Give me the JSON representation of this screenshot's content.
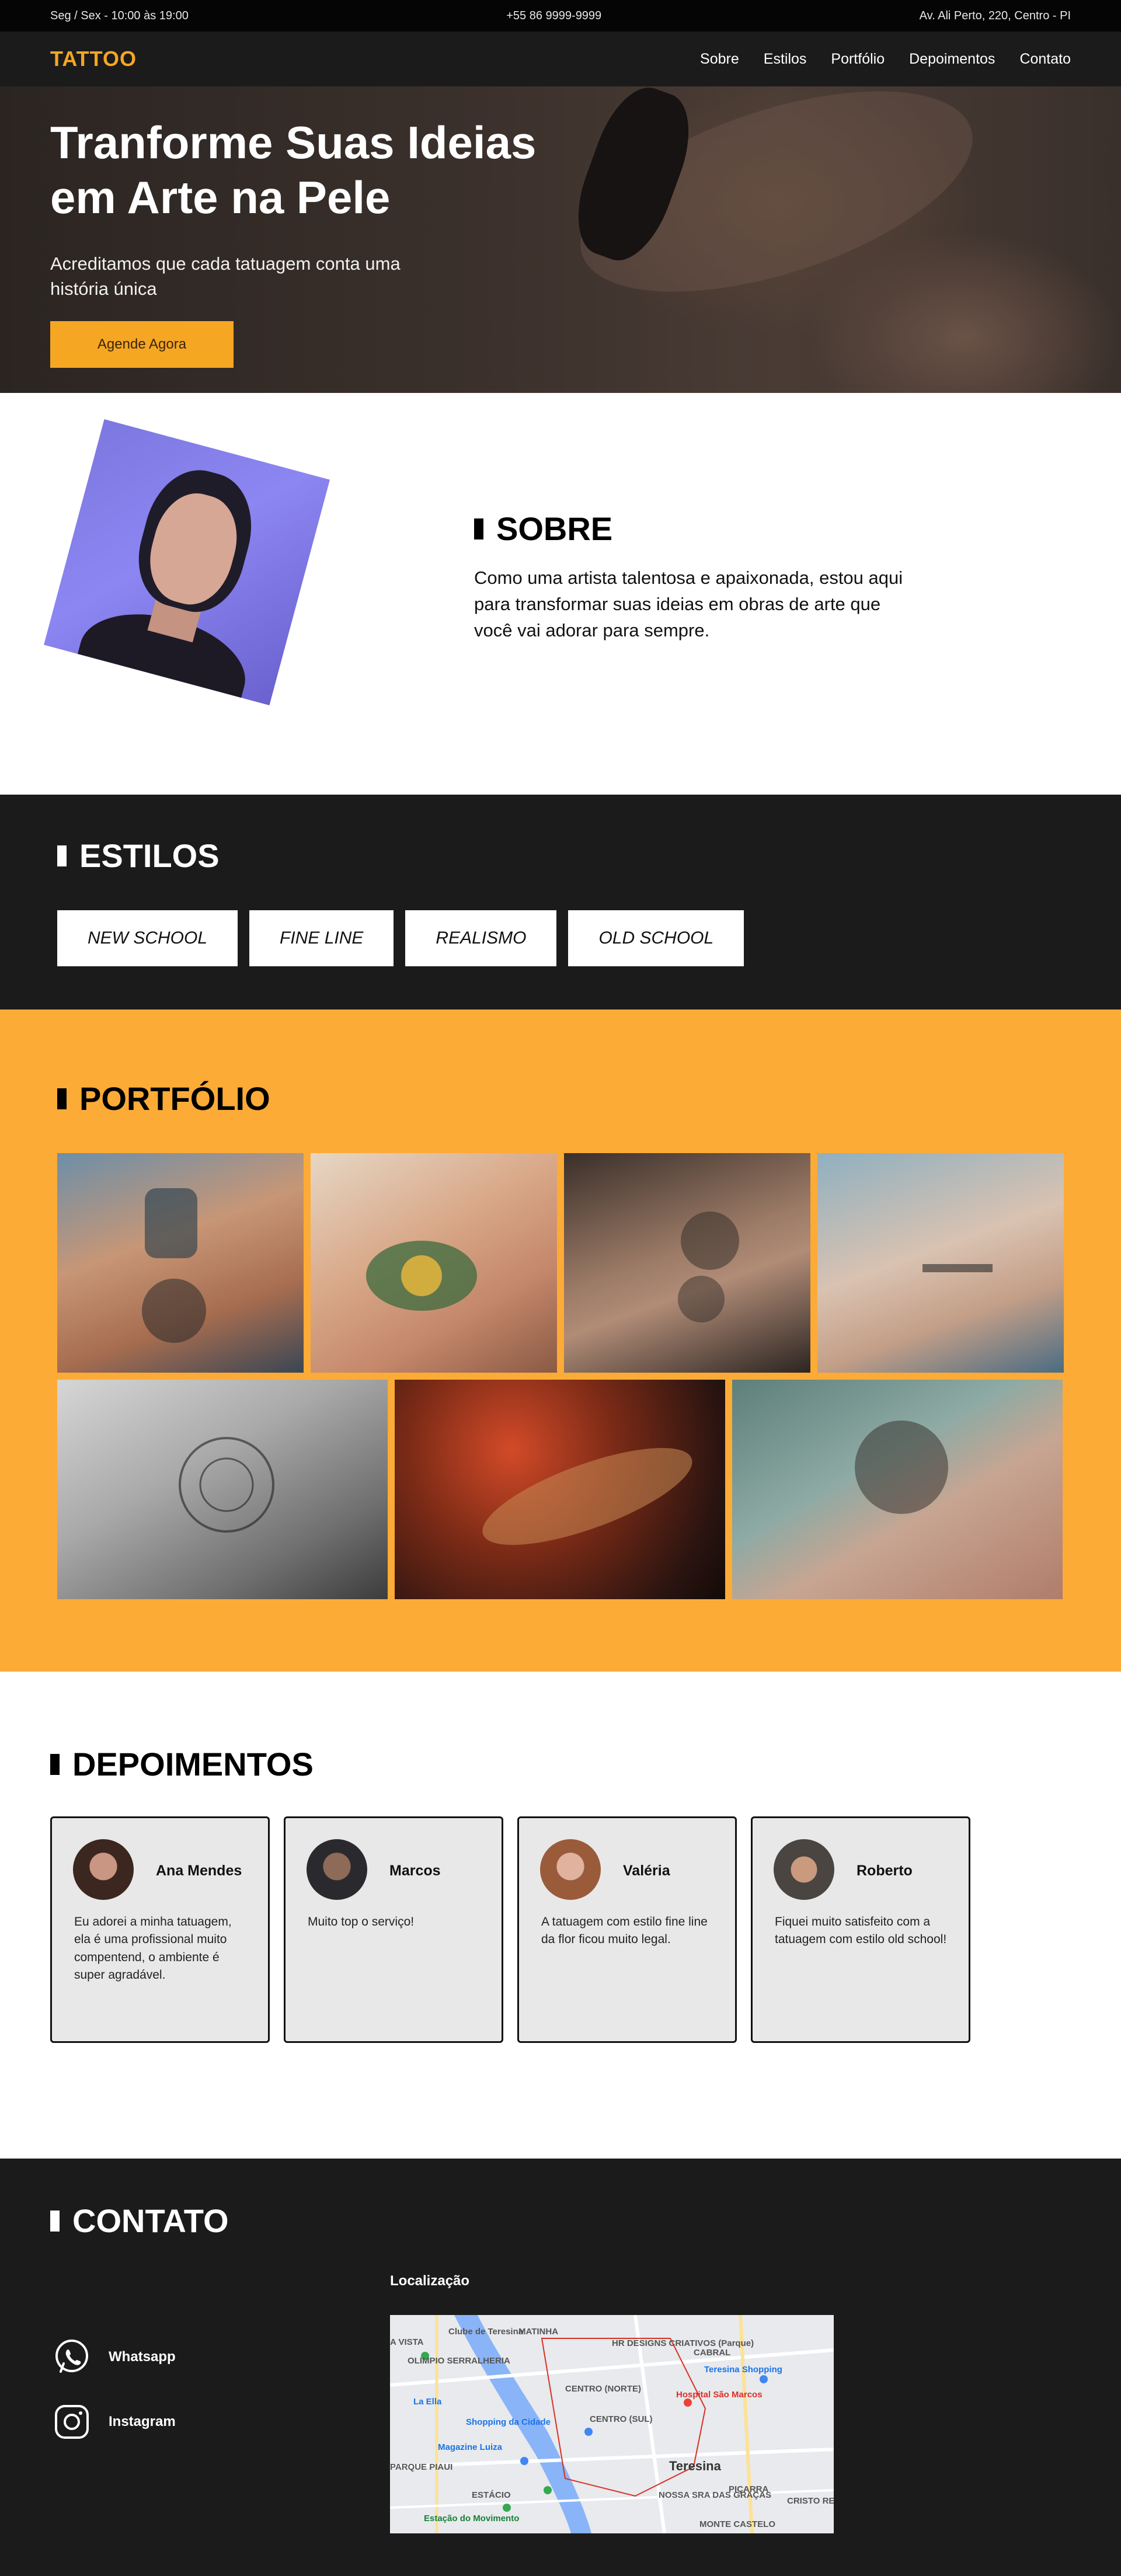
{
  "topbar": {
    "hours": "Seg / Sex - 10:00 às 19:00",
    "phone": "+55 86 9999-9999",
    "address": "Av. Ali Perto, 220, Centro - PI"
  },
  "nav": {
    "logo": "TATTOO",
    "links": [
      "Sobre",
      "Estilos",
      "Portfólio",
      "Depoimentos",
      "Contato"
    ]
  },
  "hero": {
    "title": "Tranforme Suas Ideias em Arte na Pele",
    "subtitle": "Acreditamos que cada tatuagem conta uma história única",
    "cta": "Agende Agora"
  },
  "sobre": {
    "title": "SOBRE",
    "text": "Como uma artista talentosa e apaixonada, estou aqui para transformar suas ideias em obras de arte que você vai adorar para sempre."
  },
  "estilos": {
    "title": "ESTILOS",
    "tags": [
      "NEW SCHOOL",
      "FINE LINE",
      "REALISMO",
      "OLD SCHOOL"
    ]
  },
  "portfolio": {
    "title": "PORTFÓLIO"
  },
  "depoimentos": {
    "title": "DEPOIMENTOS",
    "cards": [
      {
        "name": "Ana Mendes",
        "text": "Eu adorei a minha tatuagem, ela é uma profissional muito compentend, o ambiente é super agradável."
      },
      {
        "name": "Marcos",
        "text": "Muito top o serviço!"
      },
      {
        "name": "Valéria",
        "text": "A tatuagem com estilo fine line da flor ficou muito legal."
      },
      {
        "name": "Roberto",
        "text": "Fiquei muito satisfeito com a tatuagem com estilo old school!"
      }
    ]
  },
  "contato": {
    "title": "CONTATO",
    "location_label": "Localização",
    "whatsapp": "Whatsapp",
    "instagram": "Instagram",
    "map_labels": [
      "CENTRO (NORTE)",
      "CENTRO (SUL)",
      "Teresina",
      "Hospital São Marcos",
      "PARQUE PIAUI",
      "Shopping da Cidade",
      "Magazine Luiza",
      "Teresina Shopping",
      "CABRAL",
      "MATINHA",
      "Estação do Movimento",
      "OLIMPIO SERRALHERIA",
      "Clube de Teresina",
      "HR DESIGNS CRIATIVOS (Parque)",
      "MONTE CASTELO",
      "NOSSA SRA DAS GRAÇAS",
      "CRISTO REI",
      "PIÇARRA",
      "ESTÁCIO",
      "A VISTA",
      "La Ella"
    ]
  },
  "colors": {
    "accent": "#f5a623",
    "dark": "#1b1b1b",
    "portfolio_bg": "#fdab37"
  }
}
